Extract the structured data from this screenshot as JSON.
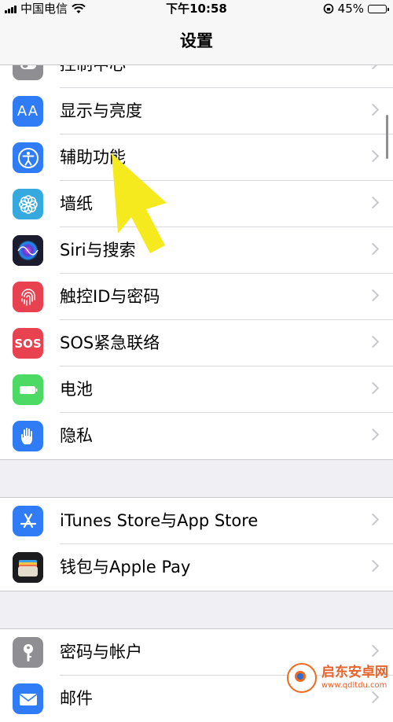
{
  "status_bar": {
    "carrier": "中国电信",
    "time": "下午10:58",
    "battery_percent": "45%",
    "battery_level": 0.45
  },
  "nav": {
    "title": "设置"
  },
  "groups": [
    {
      "items": [
        {
          "label": "控制中心",
          "icon": "control-center-icon",
          "color": "#8e8e93"
        },
        {
          "label": "显示与亮度",
          "icon": "display-brightness-icon",
          "color": "#2f7cf6"
        },
        {
          "label": "辅助功能",
          "icon": "accessibility-icon",
          "color": "#2f7cf6"
        },
        {
          "label": "墙纸",
          "icon": "wallpaper-icon",
          "color": "#36aadf"
        },
        {
          "label": "Siri与搜索",
          "icon": "siri-icon",
          "color": "#1c1c2e"
        },
        {
          "label": "触控ID与密码",
          "icon": "fingerprint-icon",
          "color": "#e8414f"
        },
        {
          "label": "SOS紧急联络",
          "icon": "sos-icon",
          "color": "#e8414f"
        },
        {
          "label": "电池",
          "icon": "battery-icon",
          "color": "#4cd964"
        },
        {
          "label": "隐私",
          "icon": "privacy-hand-icon",
          "color": "#2f7cf6"
        }
      ]
    },
    {
      "items": [
        {
          "label": "iTunes Store与App Store",
          "icon": "app-store-icon",
          "color": "#2f7cf6"
        },
        {
          "label": "钱包与Apple Pay",
          "icon": "wallet-icon",
          "color": "#1c1c1e"
        }
      ]
    },
    {
      "items": [
        {
          "label": "密码与帐户",
          "icon": "key-icon",
          "color": "#8e8e93"
        },
        {
          "label": "邮件",
          "icon": "mail-icon",
          "color": "#2f7cf6"
        }
      ]
    }
  ],
  "watermark": {
    "title": "启东安卓网",
    "url": "www.qdltdu.com"
  }
}
